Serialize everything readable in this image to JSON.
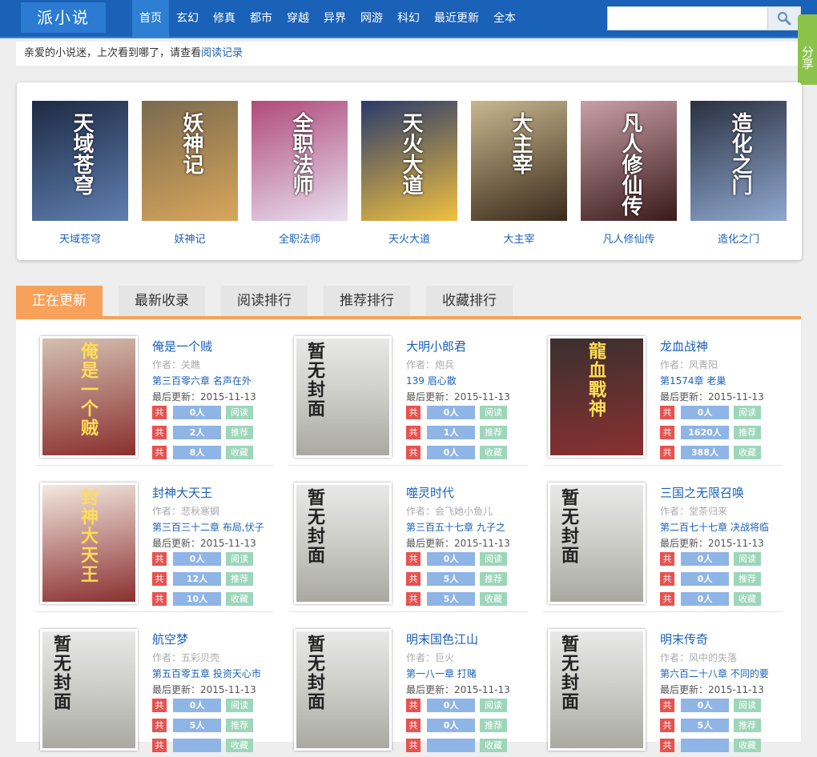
{
  "header": {
    "logo": "派小说",
    "nav": [
      "首页",
      "玄幻",
      "修真",
      "都市",
      "穿越",
      "异界",
      "网游",
      "科幻",
      "最近更新",
      "全本"
    ],
    "search_placeholder": "",
    "share": "分享"
  },
  "notice": {
    "text": "亲爱的小说迷，上次看到哪了，请查看",
    "link": "阅读记录"
  },
  "featured": [
    {
      "name": "天域苍穹",
      "cover": "#1d2a44",
      "accent": "#5f7fb0",
      "cover_text": "天域苍穹"
    },
    {
      "name": "妖神记",
      "cover": "#7a6a4f",
      "accent": "#d9a65b",
      "cover_text": "妖神记"
    },
    {
      "name": "全职法师",
      "cover": "#b04a7a",
      "accent": "#e8e0f0",
      "cover_text": "全职法师"
    },
    {
      "name": "天火大道",
      "cover": "#2a3a6a",
      "accent": "#f0c040",
      "cover_text": "天火大道"
    },
    {
      "name": "大主宰",
      "cover": "#c9b78f",
      "accent": "#3a2a1a",
      "cover_text": "大主宰"
    },
    {
      "name": "凡人修仙传",
      "cover": "#c8a0a8",
      "accent": "#3a1a1a",
      "cover_text": "凡人修仙传"
    },
    {
      "name": "造化之门",
      "cover": "#2a3040",
      "accent": "#8fa8d0",
      "cover_text": "造化之门"
    }
  ],
  "tabs": [
    "正在更新",
    "最新收录",
    "阅读排行",
    "推荐排行",
    "收藏排行"
  ],
  "labels": {
    "gong": "共",
    "read": "阅读",
    "recommend": "推荐",
    "collect": "收藏",
    "no_cover": "暂无封面"
  },
  "books": [
    {
      "title": "俺是一个贼",
      "author": "作者：关瞧",
      "chapter": "第三百零六章 名声在外",
      "updated": "最后更新：2015-11-13",
      "read": "0人",
      "recommend": "2人",
      "collect": "8人",
      "has_cover": true,
      "cover_color": "#d4c0b0",
      "cover_text": "俺是一个贼"
    },
    {
      "title": "大明小郎君",
      "author": "作者：炮兵",
      "chapter": "139 眉心散",
      "updated": "最后更新：2015-11-13",
      "read": "0人",
      "recommend": "1人",
      "collect": "0人",
      "has_cover": false
    },
    {
      "title": "龙血战神",
      "author": "作者：风青阳",
      "chapter": "第1574章 老巢",
      "updated": "最后更新：2015-11-13",
      "read": "0人",
      "recommend": "1620人",
      "collect": "388人",
      "has_cover": true,
      "cover_color": "#3a3030",
      "cover_text": "龍血戰神"
    },
    {
      "title": "封神大天王",
      "author": "作者：悲秋寒蜩",
      "chapter": "第三百三十二章 布局,伏子",
      "updated": "最后更新：2015-11-13",
      "read": "0人",
      "recommend": "12人",
      "collect": "10人",
      "has_cover": true,
      "cover_color": "#f4e8e0",
      "cover_text": "封神大天王"
    },
    {
      "title": "噬灵时代",
      "author": "作者：会飞她小鱼儿",
      "chapter": "第三百五十七章 九子之",
      "updated": "最后更新：2015-11-13",
      "read": "0人",
      "recommend": "5人",
      "collect": "5人",
      "has_cover": false
    },
    {
      "title": "三国之无限召唤",
      "author": "作者：堂茶归来",
      "chapter": "第二百七十七章 决战将临",
      "updated": "最后更新：2015-11-13",
      "read": "0人",
      "recommend": "0人",
      "collect": "0人",
      "has_cover": false
    },
    {
      "title": "航空梦",
      "author": "作者：五彩贝壳",
      "chapter": "第五百零五章 投资天心市",
      "updated": "最后更新：2015-11-13",
      "read": "0人",
      "recommend": "5人",
      "collect": "",
      "has_cover": false
    },
    {
      "title": "明末国色江山",
      "author": "作者：巨火",
      "chapter": "第一八一章 打赌",
      "updated": "最后更新：2015-11-13",
      "read": "0人",
      "recommend": "0人",
      "collect": "",
      "has_cover": false
    },
    {
      "title": "明末传奇",
      "author": "作者：风中的失落",
      "chapter": "第六百二十八章 不同的要",
      "updated": "最后更新：2015-11-13",
      "read": "0人",
      "recommend": "5人",
      "collect": "",
      "has_cover": false
    }
  ]
}
